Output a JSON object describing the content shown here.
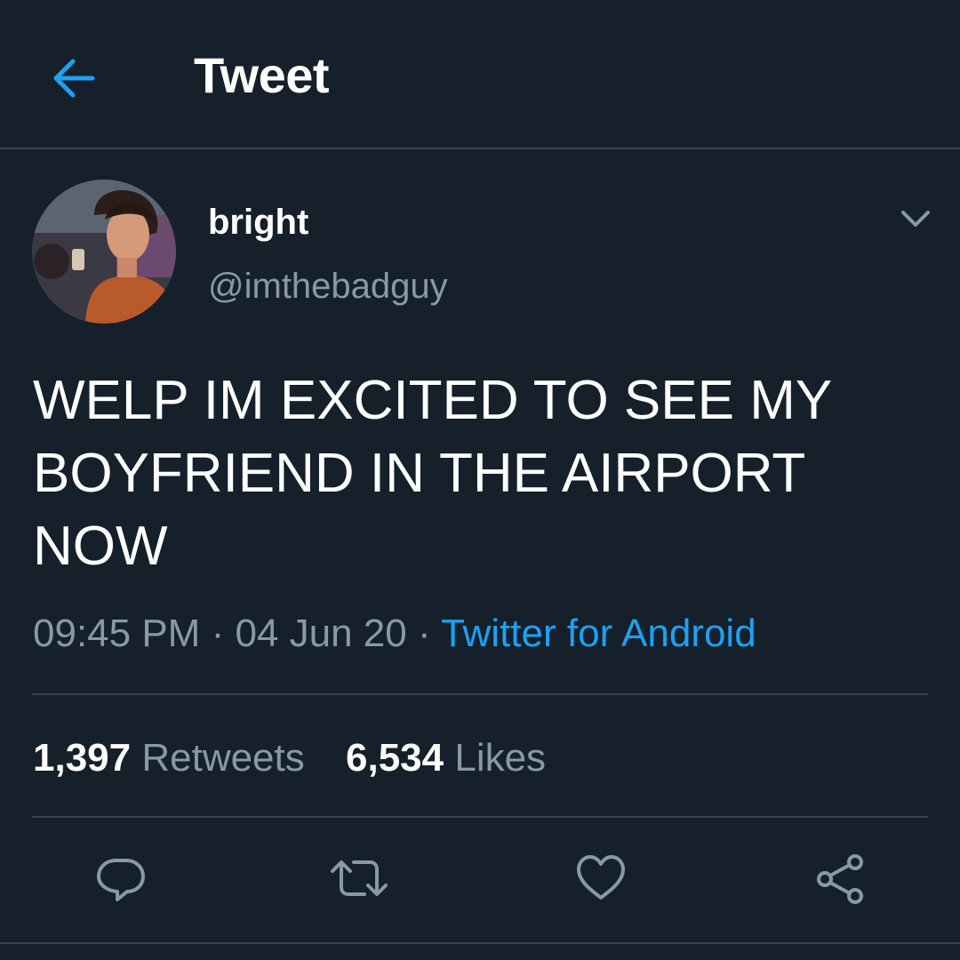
{
  "header": {
    "title": "Tweet",
    "back_icon": "arrow-left-icon"
  },
  "colors": {
    "background": "#15202b",
    "accent": "#1da1f2",
    "secondary_text": "#8899a6",
    "divider": "#38444d"
  },
  "tweet": {
    "author": {
      "name": "bright",
      "handle": "@imthebadguy"
    },
    "text": "WELP IM EXCITED TO SEE MY BOYFRIEND IN THE AIRPORT NOW",
    "time": "09:45 PM",
    "separator": "·",
    "date": "04 Jun 20",
    "source": "Twitter for Android",
    "stats": {
      "retweets_count": "1,397",
      "retweets_label": "Retweets",
      "likes_count": "6,534",
      "likes_label": "Likes"
    },
    "actions": [
      "reply-icon",
      "retweet-icon",
      "like-icon",
      "share-icon"
    ]
  }
}
